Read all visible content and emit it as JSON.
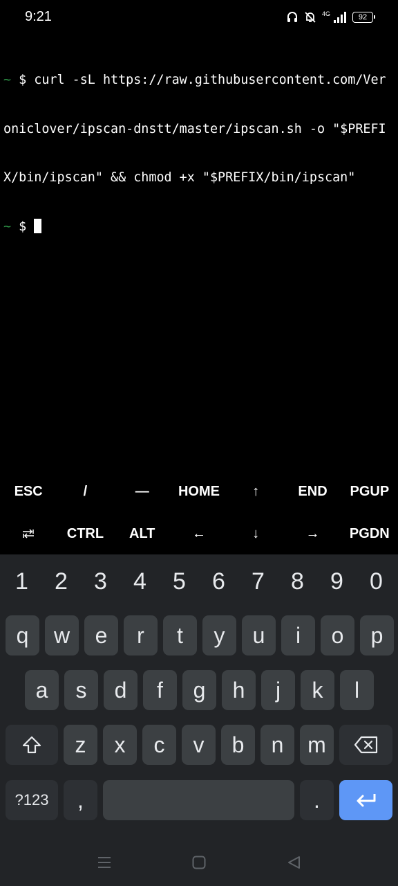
{
  "status_bar": {
    "time": "9:21",
    "network": "4G",
    "battery": "92",
    "icons": [
      "headset-icon",
      "bell-off-icon",
      "signal-icon",
      "battery-icon"
    ]
  },
  "terminal": {
    "lines": [
      {
        "prompt": "~",
        "text": " $ curl -sL https://raw.githubusercontent.com/Ver"
      },
      {
        "prompt": "",
        "text": "oniclover/ipscan-dnstt/master/ipscan.sh -o \"$PREFI"
      },
      {
        "prompt": "",
        "text": "X/bin/ipscan\" && chmod +x \"$PREFIX/bin/ipscan\""
      },
      {
        "prompt": "~",
        "text": " $ "
      }
    ],
    "prompt_color": "#2f9a49"
  },
  "extra_keys": {
    "row1": [
      "ESC",
      "/",
      "—",
      "HOME",
      "↑",
      "END",
      "PGUP"
    ],
    "row2": [
      "⭾",
      "CTRL",
      "ALT",
      "←",
      "↓",
      "→",
      "PGDN"
    ]
  },
  "keyboard": {
    "numbers": [
      "1",
      "2",
      "3",
      "4",
      "5",
      "6",
      "7",
      "8",
      "9",
      "0"
    ],
    "row1": [
      "q",
      "w",
      "e",
      "r",
      "t",
      "y",
      "u",
      "i",
      "o",
      "p"
    ],
    "row2": [
      "a",
      "s",
      "d",
      "f",
      "g",
      "h",
      "j",
      "k",
      "l"
    ],
    "row3": [
      "z",
      "x",
      "c",
      "v",
      "b",
      "n",
      "m"
    ],
    "symbols_label": "?123",
    "comma": ",",
    "period": ".",
    "colors": {
      "background": "#222427",
      "key": "#3c4043",
      "function_key": "#2d3034",
      "enter": "#5e97f6"
    }
  },
  "nav_bar": {
    "icons": [
      "recents-icon",
      "home-icon",
      "back-icon"
    ]
  }
}
